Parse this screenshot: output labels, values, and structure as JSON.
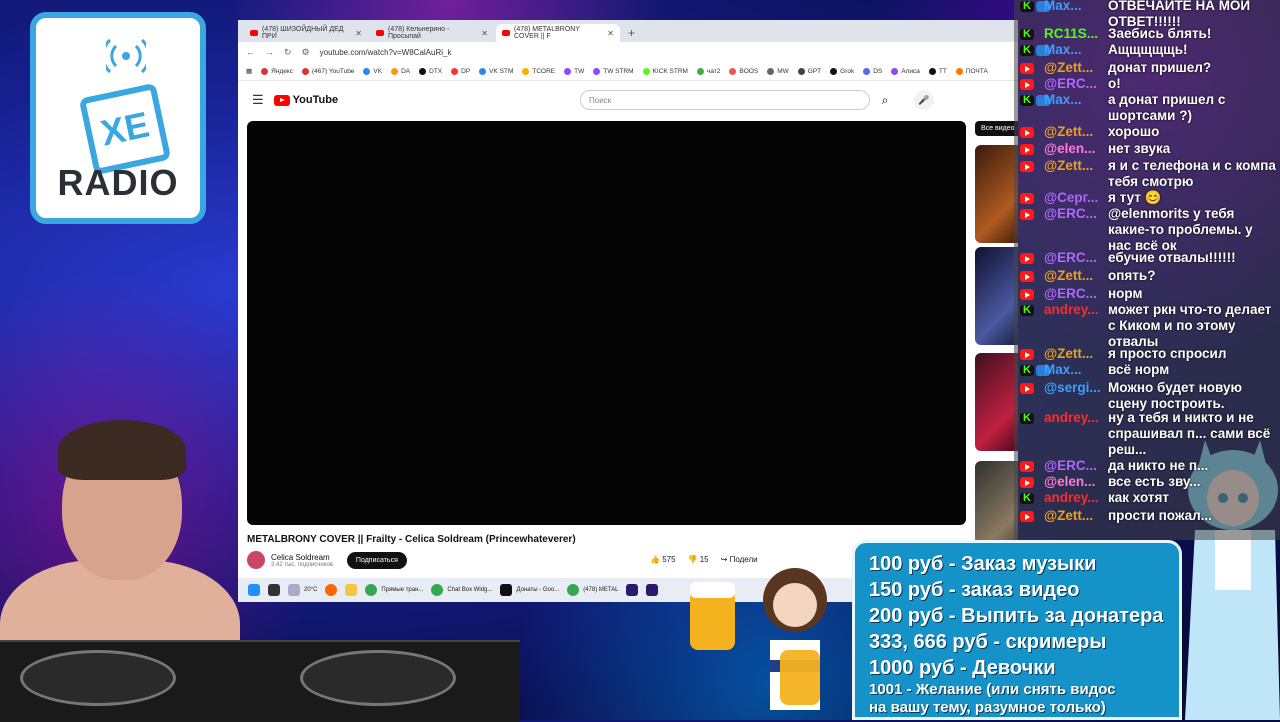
{
  "logo": {
    "top_text": "XE",
    "bottom_text": "RADIO"
  },
  "browser": {
    "tabs": [
      {
        "label": "(478) ШИЗОЙДНЫЙ ДЕД ПРИ"
      },
      {
        "label": "(478) Кельнерино - Просыпай"
      },
      {
        "label": "(478) METALBRONY COVER || F"
      }
    ],
    "new_tab": "+",
    "url": "youtube.com/watch?v=W8CalAuRi_k",
    "bookmarks": [
      "Яндекс",
      "(467) YouTube",
      "VK",
      "DA",
      "DTX",
      "DP",
      "VK STM",
      "TCORE",
      "TW",
      "TW STRM",
      "KICK STRM",
      "чат2",
      "BOOS",
      "MW",
      "GPT",
      "Grok",
      "DS",
      "Алиса",
      "TT",
      "ПОЧТА"
    ],
    "youtube": {
      "logo_text": "YouTube",
      "search_placeholder": "Поиск",
      "video_title": "METALBRONY COVER || Frailty - Celica Soldream (Princewhateverer)",
      "channel": "Celica Soldream",
      "subscribers": "3,42 тыс. подписчиков",
      "subscribe": "Подписаться",
      "likes": "575",
      "dislikes": "15",
      "share": "Подели",
      "sidebar_chip": "Все видео"
    }
  },
  "taskbar": {
    "weather": "20°C",
    "items": [
      "Прямые тран...",
      "Chat Box Widg...",
      "Донаты - Goo...",
      "(478) METAL"
    ]
  },
  "chat": [
    {
      "platform": "kick",
      "extra": true,
      "user": "Max...",
      "color": "#3aa0ff",
      "text": "ОТВЕЧАЙТЕ НА МОЙ ОТВЕТ!!!!!!"
    },
    {
      "platform": "kick",
      "extra": false,
      "user": "RC11S...",
      "color": "#53fc18",
      "text": "Заебись блять!"
    },
    {
      "platform": "kick",
      "extra": true,
      "user": "Max...",
      "color": "#3aa0ff",
      "text": "Ащщщщщь!"
    },
    {
      "platform": "youtube",
      "extra": false,
      "user": "@Zett...",
      "color": "#e8a020",
      "text": "донат пришел?"
    },
    {
      "platform": "youtube",
      "extra": false,
      "user": "@ERC...",
      "color": "#b266ff",
      "text": "о!"
    },
    {
      "platform": "kick",
      "extra": true,
      "user": "Max...",
      "color": "#3aa0ff",
      "text": "а донат пришел с шортсами ?)"
    },
    {
      "platform": "youtube",
      "extra": false,
      "user": "@Zett...",
      "color": "#e8a020",
      "text": "хорошо"
    },
    {
      "platform": "youtube",
      "extra": false,
      "user": "@elen...",
      "color": "#ff7ad9",
      "text": "нет звука"
    },
    {
      "platform": "youtube",
      "extra": false,
      "user": "@Zett...",
      "color": "#e8a020",
      "text": "я и с телефона и с компа тебя смотрю"
    },
    {
      "platform": "youtube",
      "extra": false,
      "user": "@Серг...",
      "color": "#b266ff",
      "text": "я тут 😊"
    },
    {
      "platform": "youtube",
      "extra": false,
      "user": "@ERC...",
      "color": "#b266ff",
      "text": "@elenmorits у тебя какие-то проблемы. у нас всё ок"
    },
    {
      "platform": "youtube",
      "extra": false,
      "user": "@ERC...",
      "color": "#b266ff",
      "text": "ебучие отвалы!!!!!!"
    },
    {
      "platform": "youtube",
      "extra": false,
      "user": "@Zett...",
      "color": "#e8a020",
      "text": "опять?"
    },
    {
      "platform": "youtube",
      "extra": false,
      "user": "@ERC...",
      "color": "#b266ff",
      "text": "норм"
    },
    {
      "platform": "kick",
      "extra": false,
      "user": "andrey...",
      "color": "#ff2a2a",
      "text": "может ркн что-то делает с Киком и по этому отвалы"
    },
    {
      "platform": "youtube",
      "extra": false,
      "user": "@Zett...",
      "color": "#e8a020",
      "text": "я просто спросил"
    },
    {
      "platform": "kick",
      "extra": true,
      "user": "Max...",
      "color": "#3aa0ff",
      "text": "всё норм"
    },
    {
      "platform": "youtube",
      "extra": false,
      "user": "@sergi...",
      "color": "#3aa0ff",
      "text": "Можно будет новую сцену построить."
    },
    {
      "platform": "kick",
      "extra": false,
      "user": "andrey...",
      "color": "#ff2a2a",
      "text": "ну а тебя и никто и не спрашивал п... сами всё реш..."
    },
    {
      "platform": "youtube",
      "extra": false,
      "user": "@ERC...",
      "color": "#b266ff",
      "text": "да никто не п..."
    },
    {
      "platform": "youtube",
      "extra": false,
      "user": "@elen...",
      "color": "#ff7ad9",
      "text": "все есть зву..."
    },
    {
      "platform": "kick",
      "extra": false,
      "user": "andrey...",
      "color": "#ff2a2a",
      "text": "как хотят"
    },
    {
      "platform": "youtube",
      "extra": false,
      "user": "@Zett...",
      "color": "#e8a020",
      "text": "прости пожал..."
    }
  ],
  "prices": [
    {
      "amount": "100 руб",
      "desc": " - Заказ музыки"
    },
    {
      "amount": "150 руб",
      "desc": " - заказ видео"
    },
    {
      "amount": "200 руб",
      "desc": " - Выпить за донатера"
    },
    {
      "amount": "333, 666 руб",
      "desc": " - скримеры"
    },
    {
      "amount": "1000 руб",
      "desc": " - Девочки"
    },
    {
      "amount": "1001",
      "desc": " - Желание (или снять видос"
    },
    {
      "amount": "",
      "desc": "на вашу тему, разумное только)"
    }
  ],
  "colors": {
    "brand_blue": "#3aa7e0",
    "price_panel": "#1592c8",
    "youtube_red": "#ff0000",
    "kick_green": "#53fc18"
  }
}
